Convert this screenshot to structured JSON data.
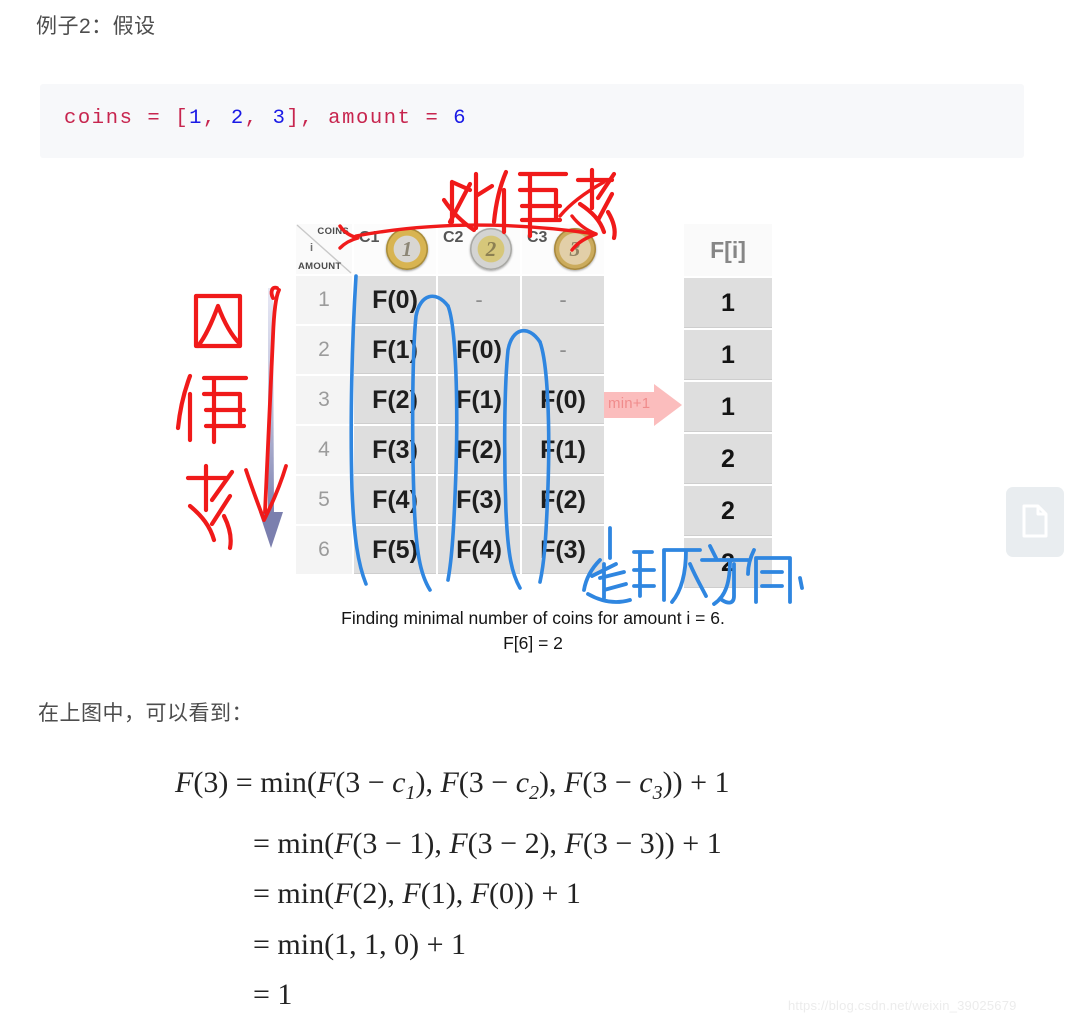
{
  "heading": "例子2：假设",
  "code": {
    "parts": [
      {
        "t": "coins = [",
        "c": "id"
      },
      {
        "t": "1",
        "c": "num"
      },
      {
        "t": ", ",
        "c": "punc"
      },
      {
        "t": "2",
        "c": "num"
      },
      {
        "t": ", ",
        "c": "punc"
      },
      {
        "t": "3",
        "c": "num"
      },
      {
        "t": "], amount = ",
        "c": "id"
      },
      {
        "t": "6",
        "c": "num"
      }
    ],
    "full_text": "coins = [1, 2, 3], amount = 6"
  },
  "figure": {
    "corner": {
      "coins_label": "COINS",
      "i_label": "i",
      "amount_label": "AMOUNT"
    },
    "coin_columns": [
      {
        "label": "C1",
        "coin_value": "1",
        "icon": "euro-coin-1"
      },
      {
        "label": "C2",
        "coin_value": "2",
        "icon": "euro-coin-2"
      },
      {
        "label": "C3",
        "coin_value": "3",
        "icon": "euro-coin-3"
      }
    ],
    "row_indices": [
      "1",
      "2",
      "3",
      "4",
      "5",
      "6"
    ],
    "cells": [
      [
        "F(0)",
        "-",
        "-"
      ],
      [
        "F(1)",
        "F(0)",
        "-"
      ],
      [
        "F(2)",
        "F(1)",
        "F(0)"
      ],
      [
        "F(3)",
        "F(2)",
        "F(1)"
      ],
      [
        "F(4)",
        "F(3)",
        "F(2)"
      ],
      [
        "F(5)",
        "F(4)",
        "F(3)"
      ]
    ],
    "fi_header": "F[i]",
    "fi_values": [
      "1",
      "1",
      "1",
      "2",
      "2",
      "2"
    ],
    "min_arrow_label": "min+1",
    "caption_line1": "Finding minimal number of coins for amount i = 6.",
    "caption_line2": "F[6] = 2",
    "annotations": {
      "outer_loop": "外循环",
      "inner_loop": "内循环",
      "traversal_direction": "遍历方向."
    },
    "colors": {
      "annotation_red": "#f01a1a",
      "annotation_blue": "#2f86e0",
      "arrow_purple": "#8286b5",
      "min_arrow_pink": "#fbbdbd"
    }
  },
  "prose": "在上图中，可以看到：",
  "math": {
    "lines": [
      [
        {
          "t": "F",
          "s": "mi"
        },
        {
          "t": "(3) = min(",
          "s": "mo"
        },
        {
          "t": "F",
          "s": "mi"
        },
        {
          "t": "(3 − ",
          "s": "mo"
        },
        {
          "t": "c",
          "s": "mi"
        },
        {
          "t": "1",
          "s": "sub"
        },
        {
          "t": "), ",
          "s": "mo"
        },
        {
          "t": "F",
          "s": "mi"
        },
        {
          "t": "(3 − ",
          "s": "mo"
        },
        {
          "t": "c",
          "s": "mi"
        },
        {
          "t": "2",
          "s": "sub"
        },
        {
          "t": "), ",
          "s": "mo"
        },
        {
          "t": "F",
          "s": "mi"
        },
        {
          "t": "(3 − ",
          "s": "mo"
        },
        {
          "t": "c",
          "s": "mi"
        },
        {
          "t": "3",
          "s": "sub"
        },
        {
          "t": ")) + 1",
          "s": "mo"
        }
      ],
      [
        {
          "t": "= min(",
          "s": "mo"
        },
        {
          "t": "F",
          "s": "mi"
        },
        {
          "t": "(3 − 1), ",
          "s": "mo"
        },
        {
          "t": "F",
          "s": "mi"
        },
        {
          "t": "(3 − 2), ",
          "s": "mo"
        },
        {
          "t": "F",
          "s": "mi"
        },
        {
          "t": "(3 − 3)) + 1",
          "s": "mo"
        }
      ],
      [
        {
          "t": "= min(",
          "s": "mo"
        },
        {
          "t": "F",
          "s": "mi"
        },
        {
          "t": "(2), ",
          "s": "mo"
        },
        {
          "t": "F",
          "s": "mi"
        },
        {
          "t": "(1), ",
          "s": "mo"
        },
        {
          "t": "F",
          "s": "mi"
        },
        {
          "t": "(0)) + 1",
          "s": "mo"
        }
      ],
      [
        {
          "t": "= min(1, 1, 0) + 1",
          "s": "mo"
        }
      ],
      [
        {
          "t": "= 1",
          "s": "mo"
        }
      ]
    ],
    "plain": [
      "F(3) = min(F(3 − c1), F(3 − c2), F(3 − c3)) + 1",
      "= min(F(3 − 1), F(3 − 2), F(3 − 3)) + 1",
      "= min(F(2), F(1), F(0)) + 1",
      "= min(1, 1, 0) + 1",
      "= 1"
    ]
  },
  "doc_widget": {
    "icon": "document-icon"
  },
  "watermark": "https://blog.csdn.net/weixin_39025679"
}
